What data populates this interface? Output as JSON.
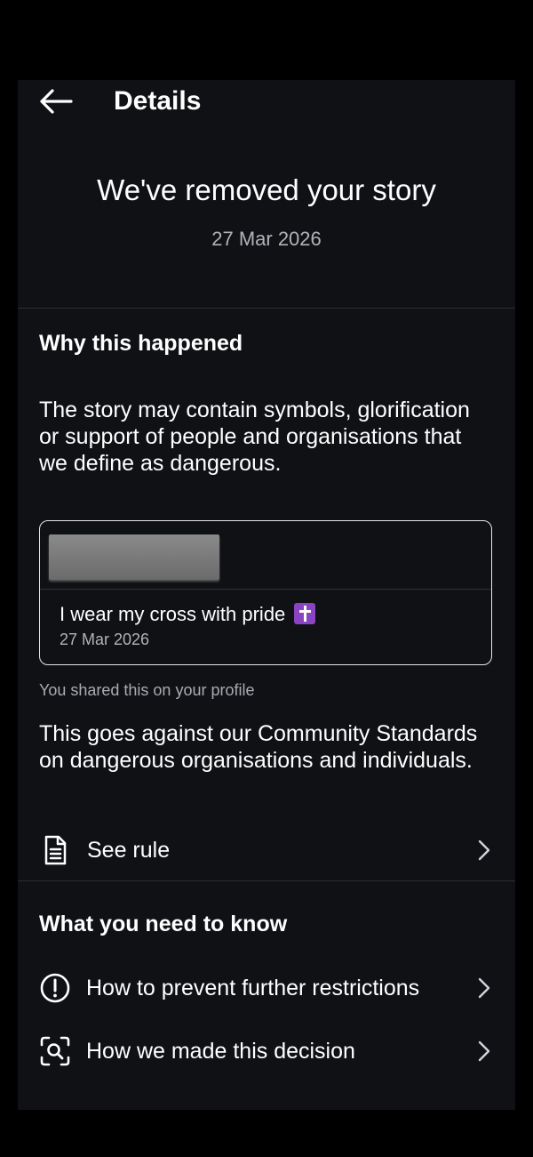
{
  "header": {
    "title": "Details"
  },
  "notice": {
    "headline": "We've removed your story",
    "date": "27 Mar 2026"
  },
  "why": {
    "title": "Why this happened",
    "description": "The story may contain symbols, glorification or support of people and organisations that we define as dangerous.",
    "post": {
      "caption": "I wear my cross with pride",
      "emoji_icon": "latin-cross-emoji",
      "date": "27 Mar 2026"
    },
    "shared_note": "You shared this on your profile",
    "standards_text": "This goes against our Community Standards on dangerous organisations and individuals.",
    "see_rule": {
      "label": "See rule",
      "icon": "document-icon"
    }
  },
  "know": {
    "title": "What you need to know",
    "items": [
      {
        "label": "How to prevent further restrictions",
        "icon": "alert-circle-icon"
      },
      {
        "label": "How we made this decision",
        "icon": "scan-search-icon"
      }
    ]
  }
}
